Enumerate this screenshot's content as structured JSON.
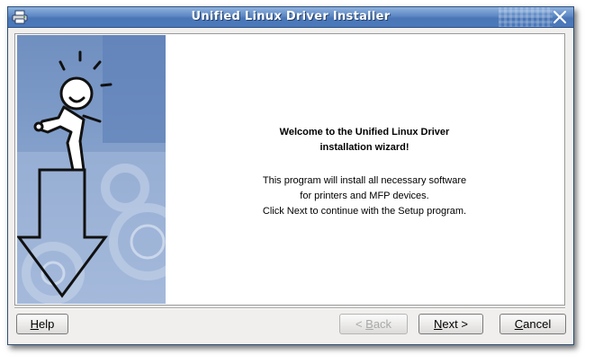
{
  "window": {
    "title": "Unified Linux Driver Installer"
  },
  "welcome": {
    "heading_line1": "Welcome to the Unified Linux Driver",
    "heading_line2": "installation wizard!",
    "body_line1": "This program will install all necessary software",
    "body_line2": "for printers and MFP devices.",
    "body_line3": "Click Next to continue with the Setup program."
  },
  "buttons": {
    "help": {
      "mnemonic": "H",
      "rest": "elp"
    },
    "back": {
      "prefix": "< ",
      "mnemonic": "B",
      "rest": "ack"
    },
    "next": {
      "mnemonic": "N",
      "rest": "ext >"
    },
    "cancel": {
      "mnemonic": "C",
      "rest": "ancel"
    }
  },
  "colors": {
    "titlebar": "#5d88c4",
    "side_panel": "#7d9bc8",
    "window_bg": "#f0efee"
  },
  "icons": [
    "printer-app-icon",
    "close-icon",
    "mascot-figure-icon",
    "down-arrow-icon"
  ]
}
